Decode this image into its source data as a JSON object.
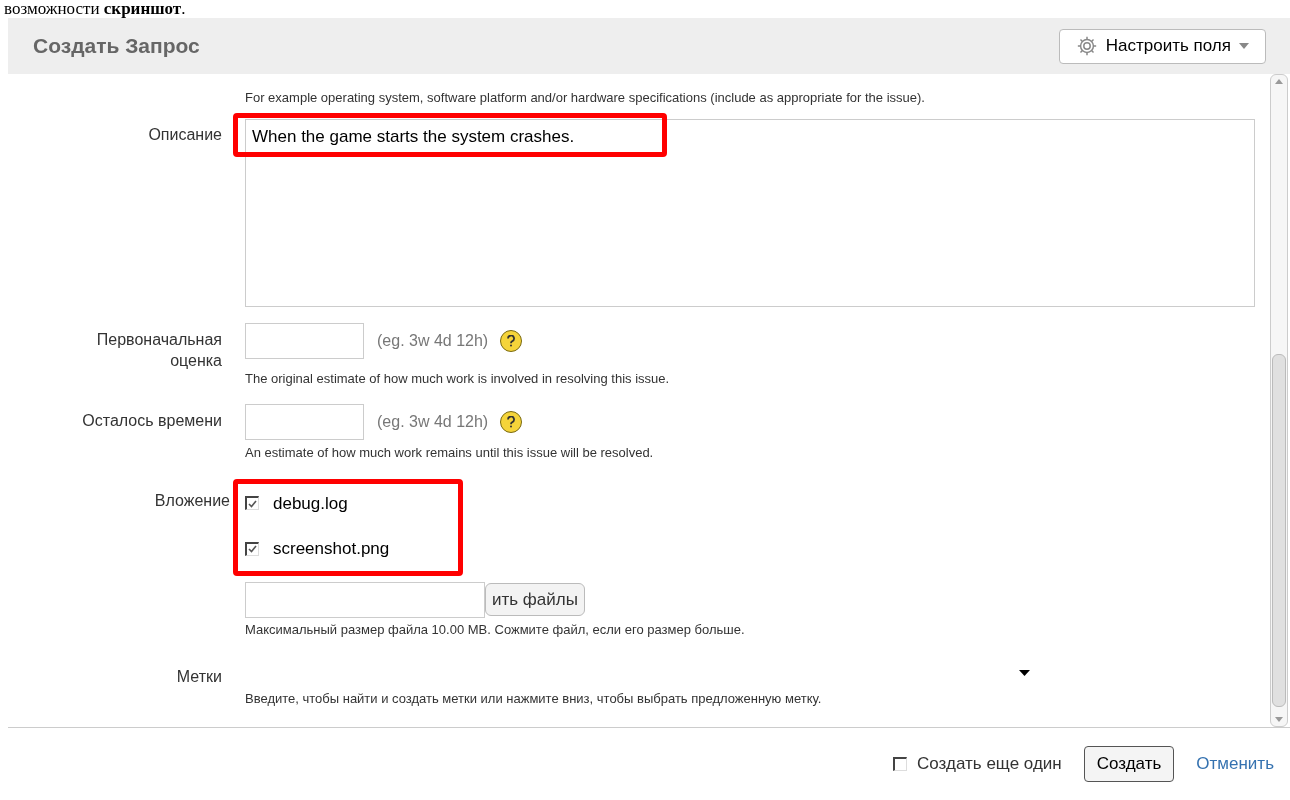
{
  "caption": "возможности **скриншот**.",
  "dialog": {
    "title": "Создать Запрос",
    "configure_button": "Настроить поля"
  },
  "top_hint": "For example operating system, software platform and/or hardware specifications (include as appropriate for the issue).",
  "description": {
    "label": "Описание",
    "value": "When the game starts the system crashes.",
    "highlighted": true
  },
  "time_fields": [
    {
      "label": "Первоначальная оценка",
      "example": "(eg. 3w 4d 12h)",
      "hint": "The original estimate of how much work is involved in resolving this issue."
    },
    {
      "label": "Осталось времени",
      "example": "(eg. 3w 4d 12h)",
      "hint": "An estimate of how much work remains until this issue will be resolved."
    }
  ],
  "attachments": {
    "label": "Вложение",
    "highlighted": true,
    "files": [
      {
        "name": "debug.log",
        "checked": true
      },
      {
        "name": "screenshot.png",
        "checked": true
      }
    ],
    "browse_button": "ить файлы",
    "hint": "Максимальный размер файла 10.00 MB. Сожмите файл, если его размер больше."
  },
  "labels": {
    "label": "Метки",
    "hint": "Введите, чтобы найти и создать метки или нажмите вниз, чтобы выбрать предложенную метку."
  },
  "footer": {
    "create_another": {
      "label": "Создать еще один",
      "checked": false
    },
    "create_button": "Создать",
    "cancel_link": "Отменить"
  }
}
